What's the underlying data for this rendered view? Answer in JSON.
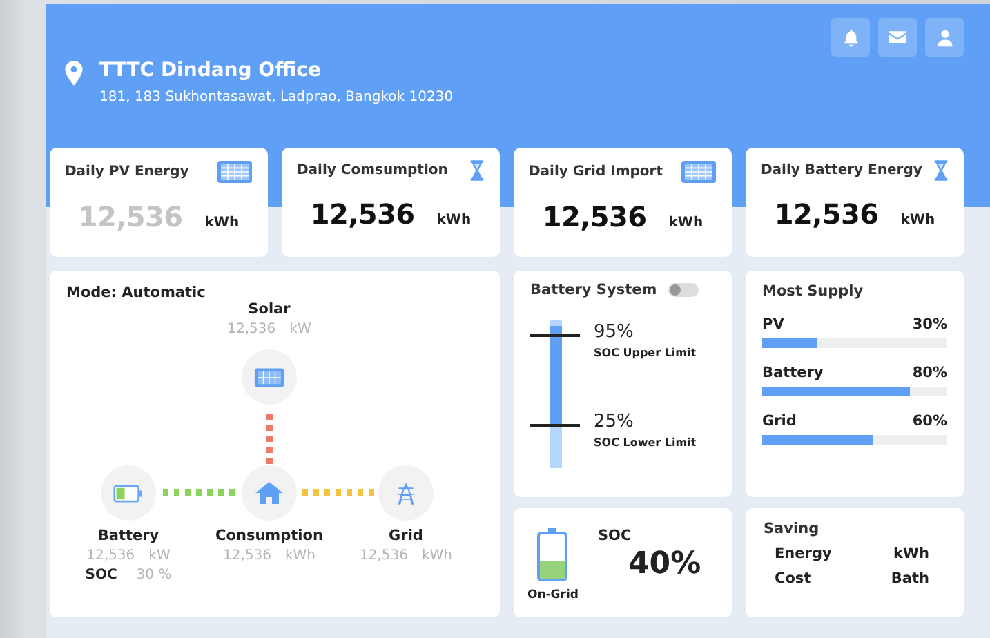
{
  "header": {
    "title": "TTTC Dindang Office",
    "address": "181, 183 Sukhontasawat, Ladprao, Bangkok 10230"
  },
  "kpis": [
    {
      "title": "Daily PV Energy",
      "value": "12,536",
      "unit": "kWh",
      "dim": true
    },
    {
      "title": "Daily Comsumption",
      "value": "12,536",
      "unit": "kWh",
      "dim": false
    },
    {
      "title": "Daily Grid Import",
      "value": "12,536",
      "unit": "kWh",
      "dim": false
    },
    {
      "title": "Daily Battery Energy",
      "value": "12,536",
      "unit": "kWh",
      "dim": false
    }
  ],
  "flow": {
    "mode_label": "Mode:",
    "mode": "Automatic",
    "nodes": [
      {
        "kind": "solar",
        "name": "Solar",
        "value": "12,536",
        "unit": "kW",
        "color": "#f07a6a"
      },
      {
        "kind": "battery",
        "name": "Battery",
        "value": "12,536",
        "unit": "kW",
        "color": "#8bd35a",
        "soc_label": "SOC",
        "soc": "30 %"
      },
      {
        "kind": "home",
        "name": "Consumption",
        "value": "12,536",
        "unit": "kWh"
      },
      {
        "kind": "grid",
        "name": "Grid",
        "value": "12,536",
        "unit": "kWh",
        "color": "#f5c242"
      }
    ]
  },
  "battery_system": {
    "title": "Battery System",
    "on": false,
    "limits": [
      {
        "value": "95%",
        "label": "SOC Upper Limit",
        "level": 0.9
      },
      {
        "value": "25%",
        "label": "SOC Lower Limit",
        "level": 0.29
      }
    ]
  },
  "soc": {
    "status": "On-Grid",
    "label": "SOC",
    "value": "40%",
    "level": 0.4
  },
  "most_supply": {
    "title": "Most Supply",
    "items": [
      {
        "name": "PV",
        "value": "30%",
        "level": 0.3
      },
      {
        "name": "Battery",
        "value": "80%",
        "level": 0.8
      },
      {
        "name": "Grid",
        "value": "60%",
        "level": 0.6
      }
    ]
  },
  "saving": {
    "title": "Saving",
    "rows": [
      {
        "label": "Energy",
        "unit": "kWh"
      },
      {
        "label": "Cost",
        "unit": "Bath"
      }
    ]
  }
}
